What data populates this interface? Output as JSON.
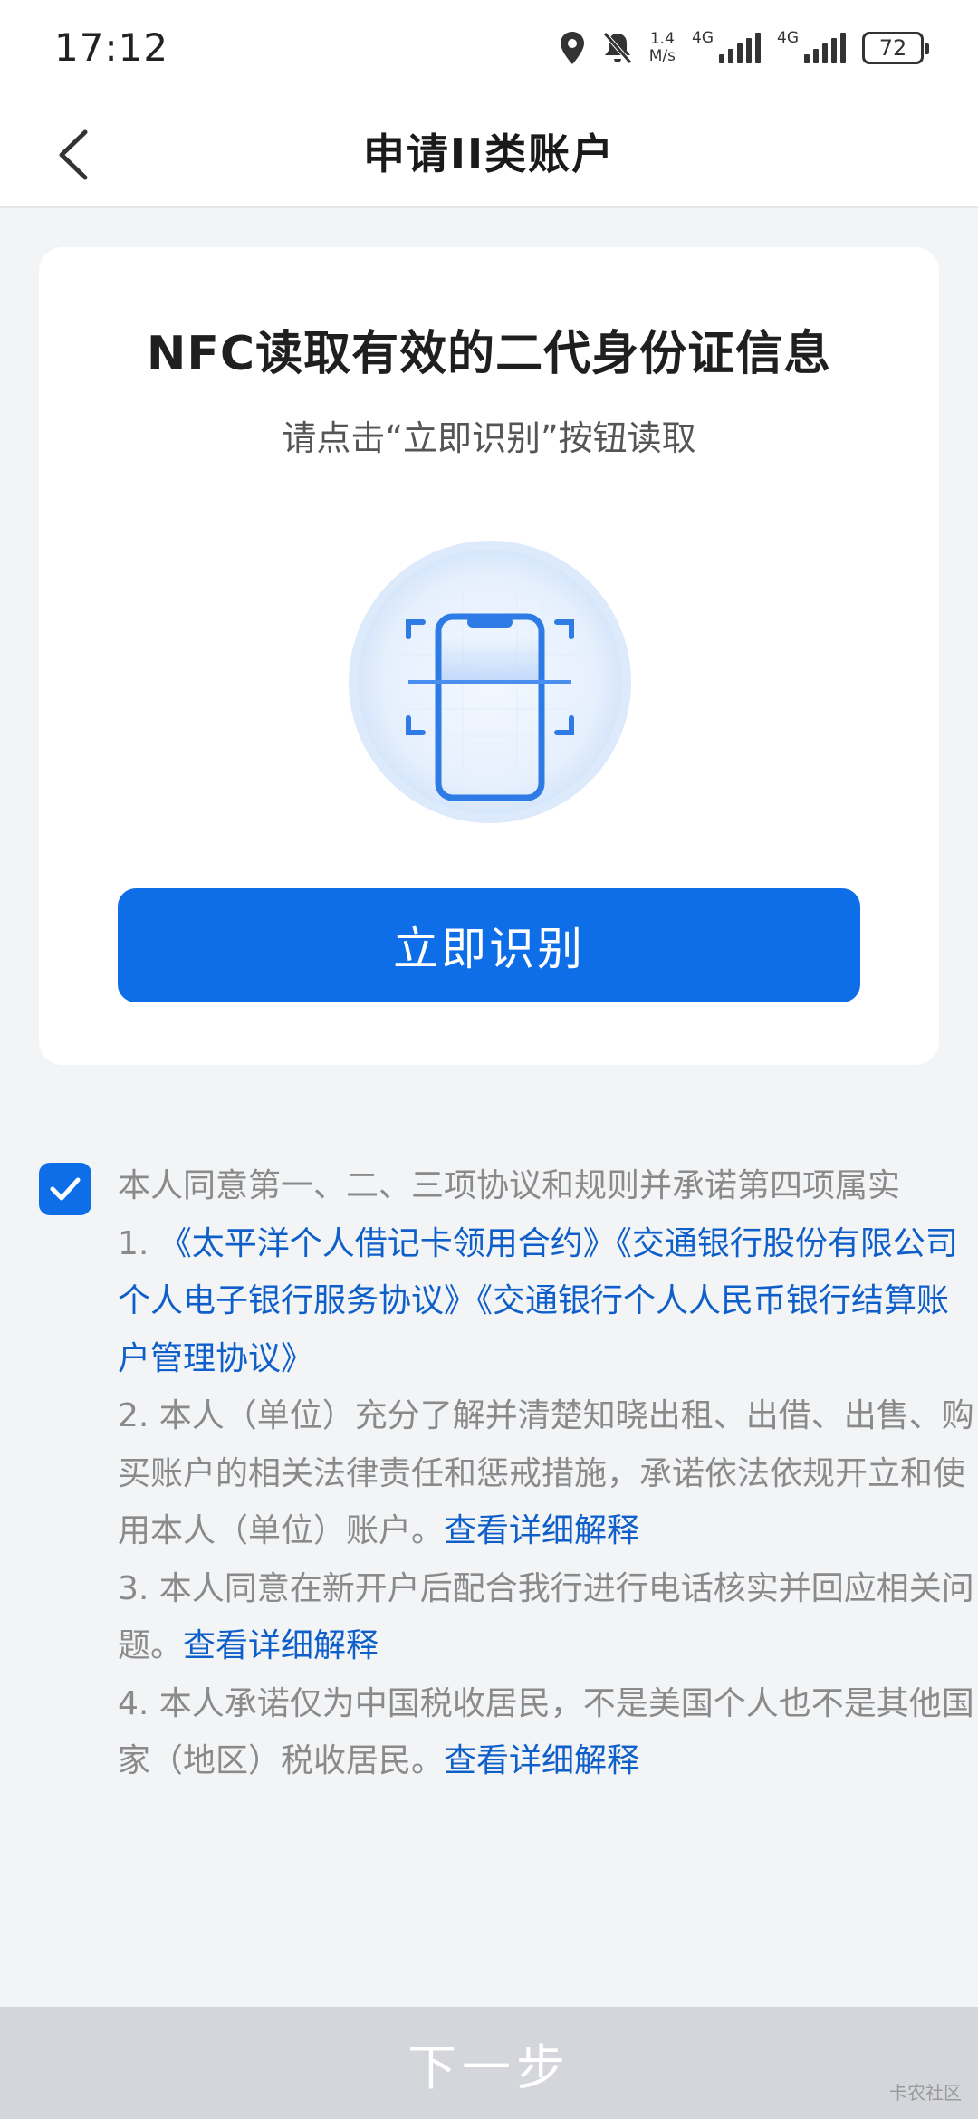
{
  "status_bar": {
    "time": "17:12",
    "net_speed_value": "1.4",
    "net_speed_unit": "M/s",
    "signal1_tag": "4G",
    "signal2_tag": "4G",
    "battery": "72",
    "icons": [
      "location-icon",
      "bell-off-icon",
      "signal-icon",
      "signal-icon",
      "battery-icon"
    ]
  },
  "nav": {
    "title": "申请II类账户",
    "back_icon": "chevron-left-icon"
  },
  "card": {
    "title": "NFC读取有效的二代身份证信息",
    "subtitle": "请点击“立即识别”按钮读取",
    "illustration_icon": "phone-nfc-scan-icon",
    "button_label": "立即识别"
  },
  "agreement": {
    "checked": true,
    "intro": "本人同意第一、二、三项协议和规则并承诺第四项属实",
    "item1_prefix": "1. ",
    "item1_link1": "《太平洋个人借记卡领用合约》",
    "item1_link2": "《交通银行股份有限公司个人电子银行服务协议》",
    "item1_link3": "《交通银行个人人民币银行结算账户管理协议》",
    "item2_text": "2. 本人（单位）充分了解并清楚知晓出租、出借、出售、购买账户的相关法律责任和惩戒措施，承诺依法依规开立和使用本人（单位）账户。",
    "item2_link": "查看详细解释",
    "item3_text": "3. 本人同意在新开户后配合我行进行电话核实并回应相关问题。",
    "item3_link": "查看详细解释",
    "item4_text": "4. 本人承诺仅为中国税收居民，不是美国个人也不是其他国家（地区）税收居民。",
    "item4_link": "查看详细解释"
  },
  "footer": {
    "next_label": "下一步",
    "watermark": "卡农社区"
  },
  "colors": {
    "primary": "#0e6ee8",
    "link": "#0e5fc9",
    "muted_text": "#8a8a8a",
    "disabled_bar": "#d4d6db"
  }
}
